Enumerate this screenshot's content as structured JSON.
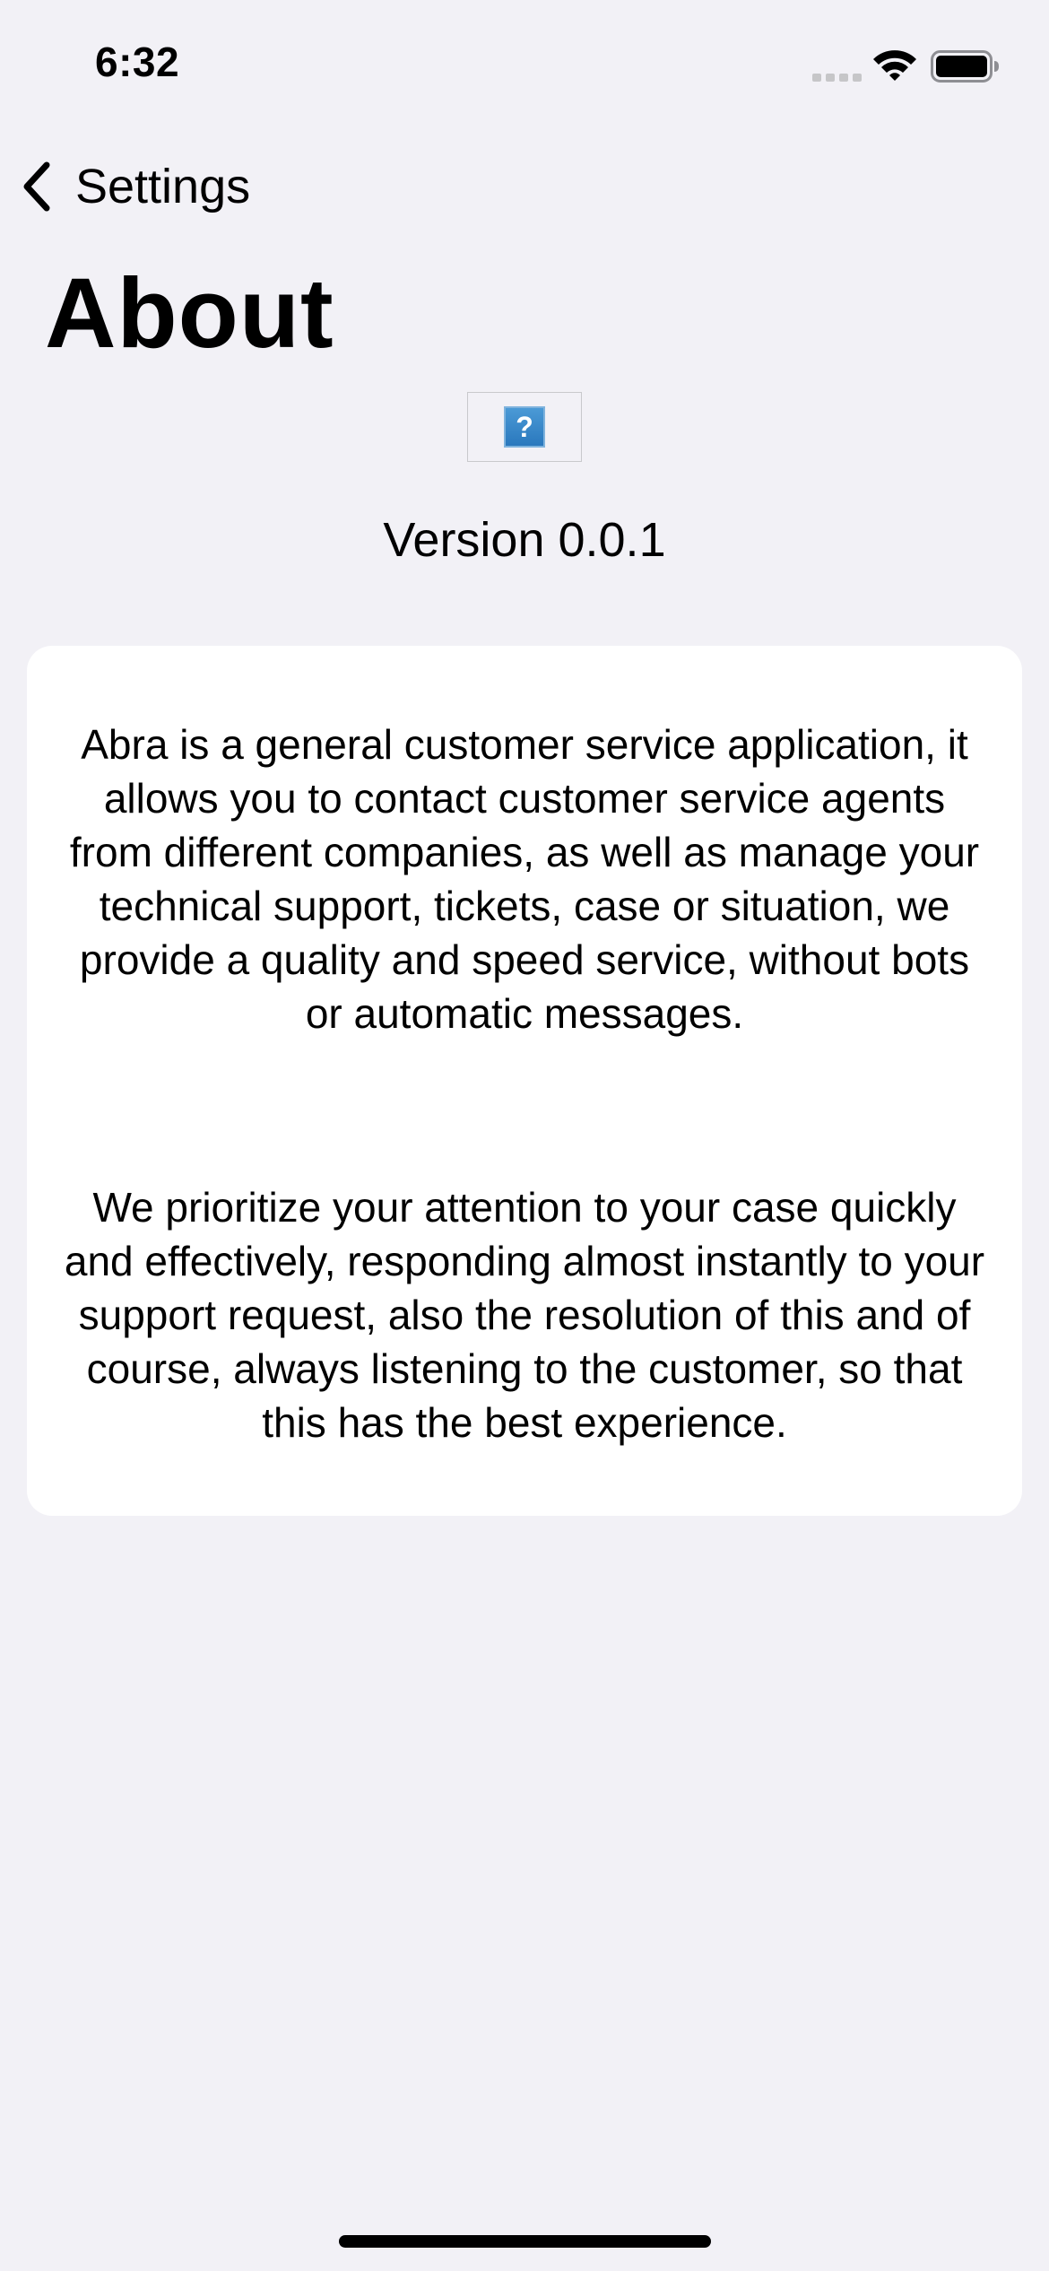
{
  "status_bar": {
    "time": "6:32",
    "icons": [
      "signal-icon",
      "wifi-icon",
      "battery-icon"
    ]
  },
  "nav": {
    "back_label": "Settings",
    "back_icon": "chevron-left-icon"
  },
  "page": {
    "title": "About"
  },
  "app": {
    "logo_icon": "broken-image-icon",
    "logo_glyph": "?",
    "version": "Version 0.0.1"
  },
  "about": {
    "paragraph_1": "Abra is a general customer service application, it allows you to contact customer service agents from different companies, as well as manage your technical support, tickets, case or situation, we provide a quality and speed service, without bots or automatic messages.",
    "paragraph_2": "We prioritize your attention to your case quickly and effectively, responding almost instantly to your support request, also the resolution of this and of course, always listening to the customer, so that this has the best experience."
  },
  "colors": {
    "background": "#f2f1f6",
    "card": "#ffffff",
    "text": "#000000",
    "logo_blue": "#2a78bd"
  }
}
